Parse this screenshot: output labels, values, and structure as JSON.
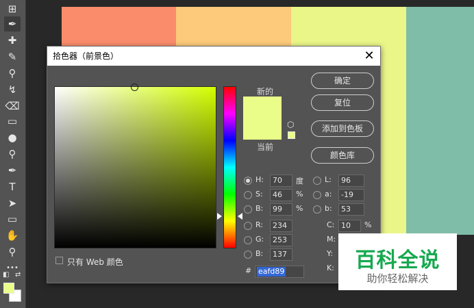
{
  "toolbar": {
    "tools": [
      {
        "name": "move-tool-icon",
        "glyph": "⊞"
      },
      {
        "name": "eyedropper-tool-icon",
        "glyph": "✒",
        "active": true
      },
      {
        "name": "healing-brush-tool-icon",
        "glyph": "✚"
      },
      {
        "name": "brush-tool-icon",
        "glyph": "✎"
      },
      {
        "name": "clone-stamp-tool-icon",
        "glyph": "⚲"
      },
      {
        "name": "history-brush-tool-icon",
        "glyph": "↯"
      },
      {
        "name": "eraser-tool-icon",
        "glyph": "⌫"
      },
      {
        "name": "gradient-tool-icon",
        "glyph": "▭"
      },
      {
        "name": "blur-tool-icon",
        "glyph": "●"
      },
      {
        "name": "dodge-tool-icon",
        "glyph": "⚲"
      },
      {
        "name": "pen-tool-icon",
        "glyph": "✒"
      },
      {
        "name": "type-tool-icon",
        "glyph": "T"
      },
      {
        "name": "path-selection-tool-icon",
        "glyph": "➤"
      },
      {
        "name": "rectangle-tool-icon",
        "glyph": "▭"
      },
      {
        "name": "hand-tool-icon",
        "glyph": "✋"
      },
      {
        "name": "zoom-tool-icon",
        "glyph": "⚲"
      },
      {
        "name": "more-tools-icon",
        "glyph": "•••"
      }
    ],
    "foreground_color": "#eafd89",
    "background_color": "#ffffff"
  },
  "canvas": {
    "blocks": [
      {
        "color": "#fa8c6c"
      },
      {
        "color": "#fcca7a"
      },
      {
        "color": "#eaf688"
      },
      {
        "color": "#80bda8"
      }
    ]
  },
  "dialog": {
    "title": "拾色器（前景色）",
    "new_label": "新的",
    "current_label": "当前",
    "new_color": "#eafd89",
    "current_color": "#eafd89",
    "buttons": {
      "ok": "确定",
      "reset": "复位",
      "add_to_swatches": "添加到色板",
      "color_libraries": "颜色库"
    },
    "hsb": {
      "h_label": "H:",
      "h_value": "70",
      "h_unit": "度",
      "s_label": "S:",
      "s_value": "46",
      "s_unit": "%",
      "b_label": "B:",
      "b_value": "99",
      "b_unit": "%"
    },
    "rgb": {
      "r_label": "R:",
      "r_value": "234",
      "g_label": "G:",
      "g_value": "253",
      "b_label": "B:",
      "b_value": "137"
    },
    "lab": {
      "l_label": "L:",
      "l_value": "96",
      "a_label": "a:",
      "a_value": "-19",
      "b_label": "b:",
      "b_value": "53"
    },
    "cmyk": {
      "c_label": "C:",
      "c_value": "10",
      "c_unit": "%",
      "m_label": "M:",
      "y_label": "Y:",
      "k_label": "K:"
    },
    "hex_hash": "#",
    "hex_value": "eafd89",
    "web_only_label": "只有 Web 颜色"
  },
  "watermark": {
    "title": "百科全说",
    "subtitle": "助你轻松解决"
  }
}
